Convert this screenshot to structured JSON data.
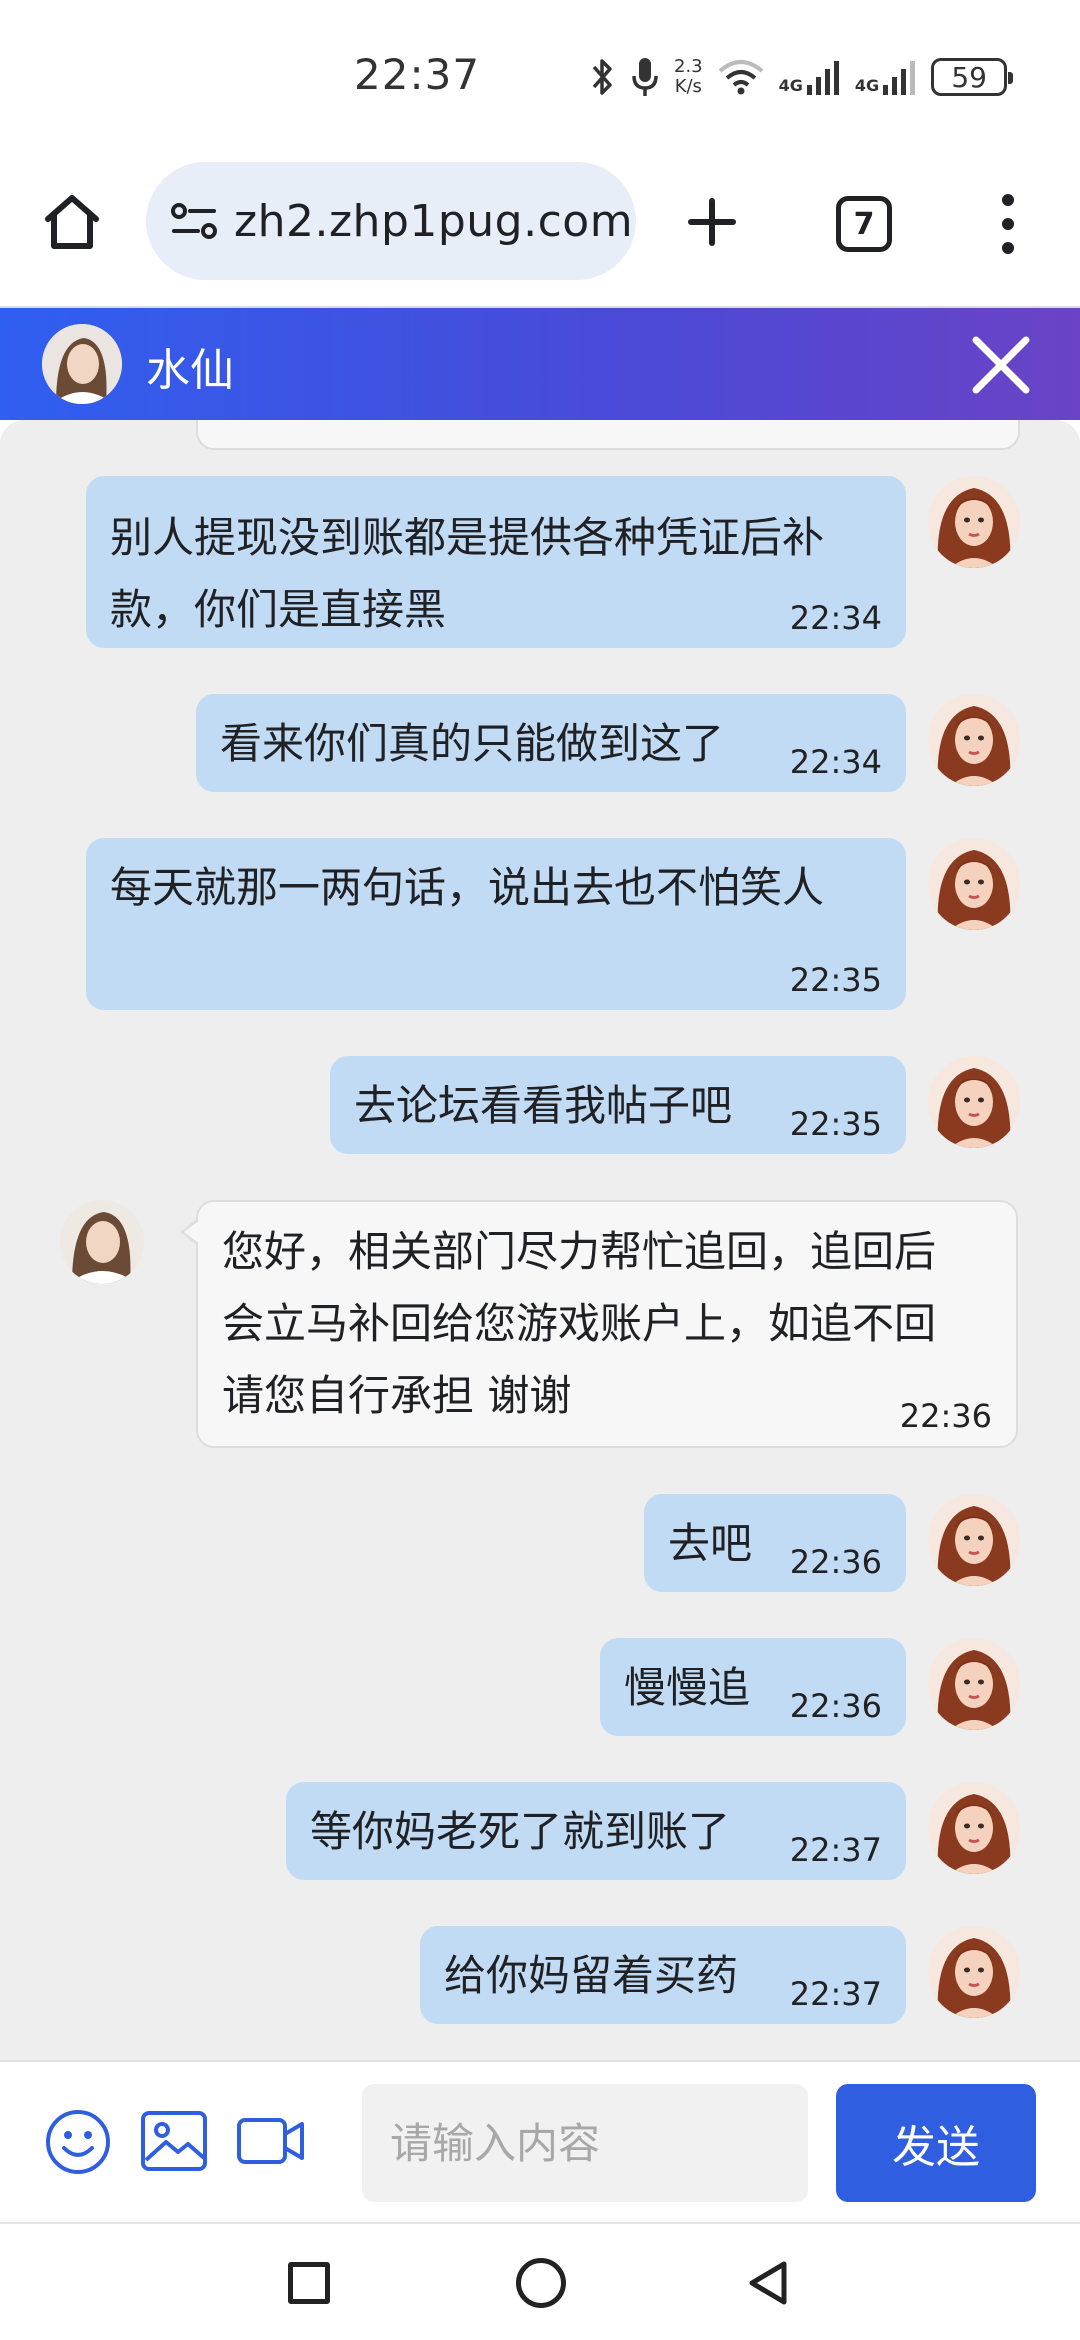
{
  "status_bar": {
    "time": "22:37",
    "net_speed_value": "2.3",
    "net_speed_unit": "K/s",
    "network_1": "4G",
    "network_2": "4G",
    "battery": "59"
  },
  "browser": {
    "url": "zh2.zhp1pug.com",
    "tab_count": "7"
  },
  "chat_header": {
    "title": "水仙"
  },
  "messages": [
    {
      "side": "out",
      "text": "别人提现没到账都是提供各种凭证后补\n款，你们是直接黑",
      "time": "22:34"
    },
    {
      "side": "out",
      "text": "看来你们真的只能做到这了",
      "time": "22:34"
    },
    {
      "side": "out",
      "text": "每天就那一两句话，说出去也不怕笑人",
      "time": "22:35"
    },
    {
      "side": "out",
      "text": "去论坛看看我帖子吧",
      "time": "22:35"
    },
    {
      "side": "in",
      "text": "您好，相关部门尽力帮忙追回，追回后\n会立马补回给您游戏账户上，如追不回\n请您自行承担 谢谢",
      "time": "22:36"
    },
    {
      "side": "out",
      "text": "去吧",
      "time": "22:36"
    },
    {
      "side": "out",
      "text": "慢慢追",
      "time": "22:36"
    },
    {
      "side": "out",
      "text": "等你妈老死了就到账了",
      "time": "22:37"
    },
    {
      "side": "out",
      "text": "给你妈留着买药",
      "time": "22:37"
    }
  ],
  "input_bar": {
    "placeholder": "请输入内容",
    "send_label": "发送"
  },
  "colors": {
    "header_gradient_start": "#2f5ff0",
    "header_gradient_end": "#6a43c6",
    "bubble_out": "#c2dbf4",
    "bubble_in": "#f7f7f7",
    "send_button": "#2f5fe0",
    "chat_background": "#eeeeee"
  }
}
